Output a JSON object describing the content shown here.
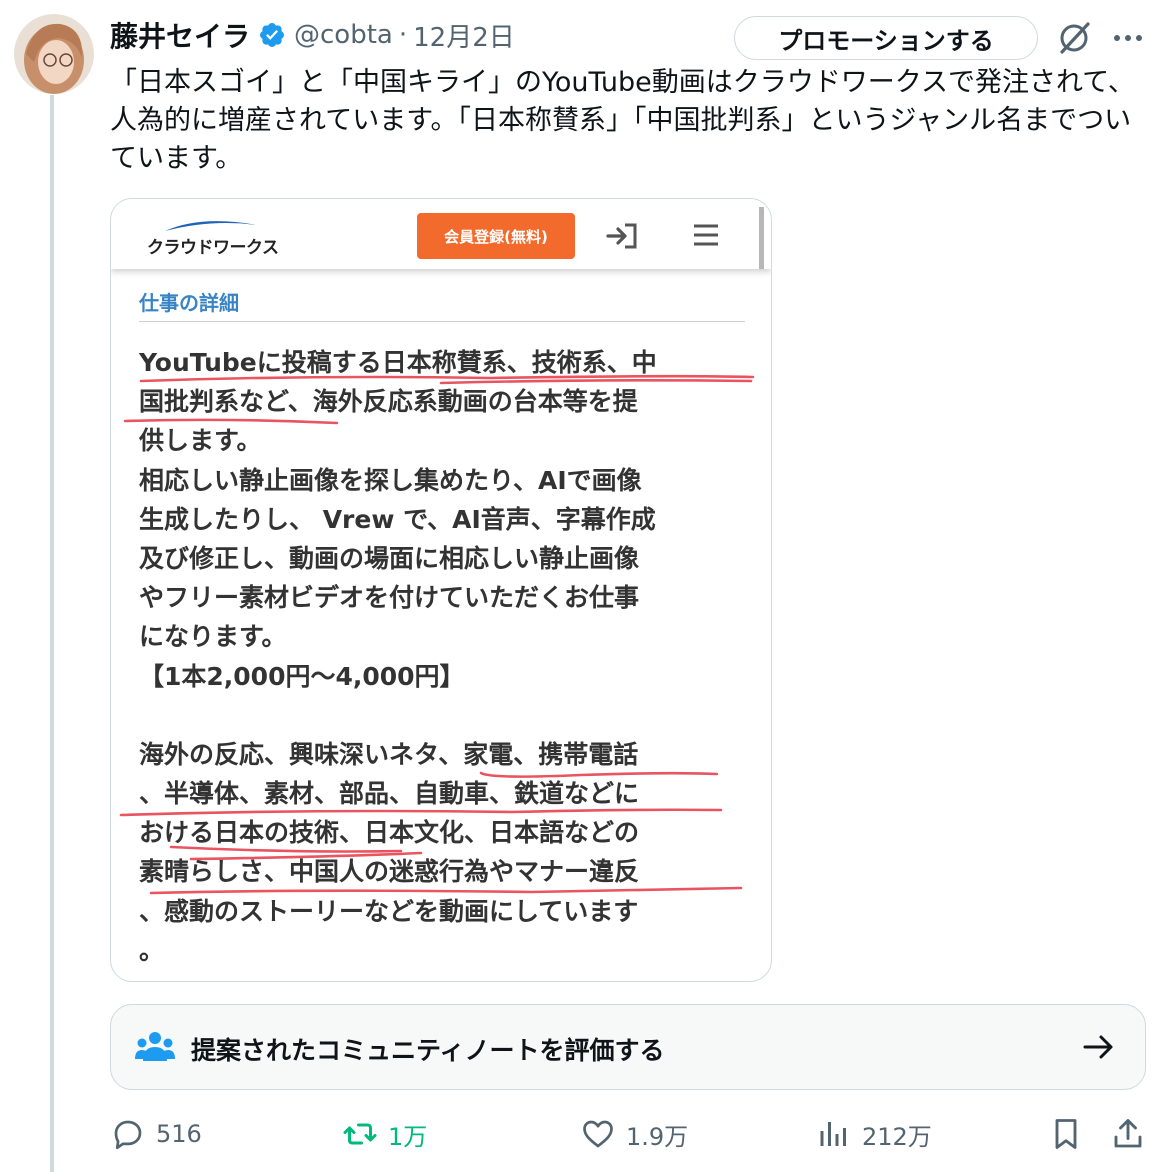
{
  "tweet": {
    "author_name": "藤井セイラ",
    "handle": "@cobta",
    "separator": "·",
    "date": "12月2日",
    "promote_label": "プロモーションする",
    "text": "「日本スゴイ」と「中国キライ」のYouTube動画はクラウドワークスで発注されて、人為的に増産されています。「日本称賛系」「中国批判系」というジャンル名までついています。"
  },
  "media": {
    "logo_text": "クラウドワークス",
    "register_button": "会員登録(無料)",
    "section_title": "仕事の詳細",
    "body_lines": [
      "YouTubeに投稿する日本称賛系、技術系、中",
      "国批判系など、海外反応系動画の台本等を提",
      "供します。",
      "相応しい静止画像を探し集めたり、AIで画像",
      "生成したりし、 Vrew で、AI音声、字幕作成",
      "及び修正し、動画の場面に相応しい静止画像",
      "やフリー素材ビデオを付けていただくお仕事",
      "になります。",
      "【1本2,000円〜4,000円】",
      "",
      "海外の反応、興味深いネタ、家電、携帯電話",
      "、半導体、素材、部品、自動車、鉄道などに",
      "おける日本の技術、日本文化、日本語などの",
      "素晴らしさ、中国人の迷惑行為やマナー違反",
      "、感動のストーリーなどを動画にしています",
      "。"
    ],
    "highlight_color": "#e8424f"
  },
  "community_note": {
    "label": "提案されたコミュニティノートを評価する"
  },
  "actions": {
    "replies": "516",
    "retweets": "1万",
    "likes": "1.9万",
    "views": "212万"
  },
  "colors": {
    "verified": "#1d9bf0",
    "retweet_green": "#00ba7c",
    "muted": "#536471",
    "crowdworks_orange": "#f36b2c",
    "crowdworks_blue": "#3a84c5"
  }
}
